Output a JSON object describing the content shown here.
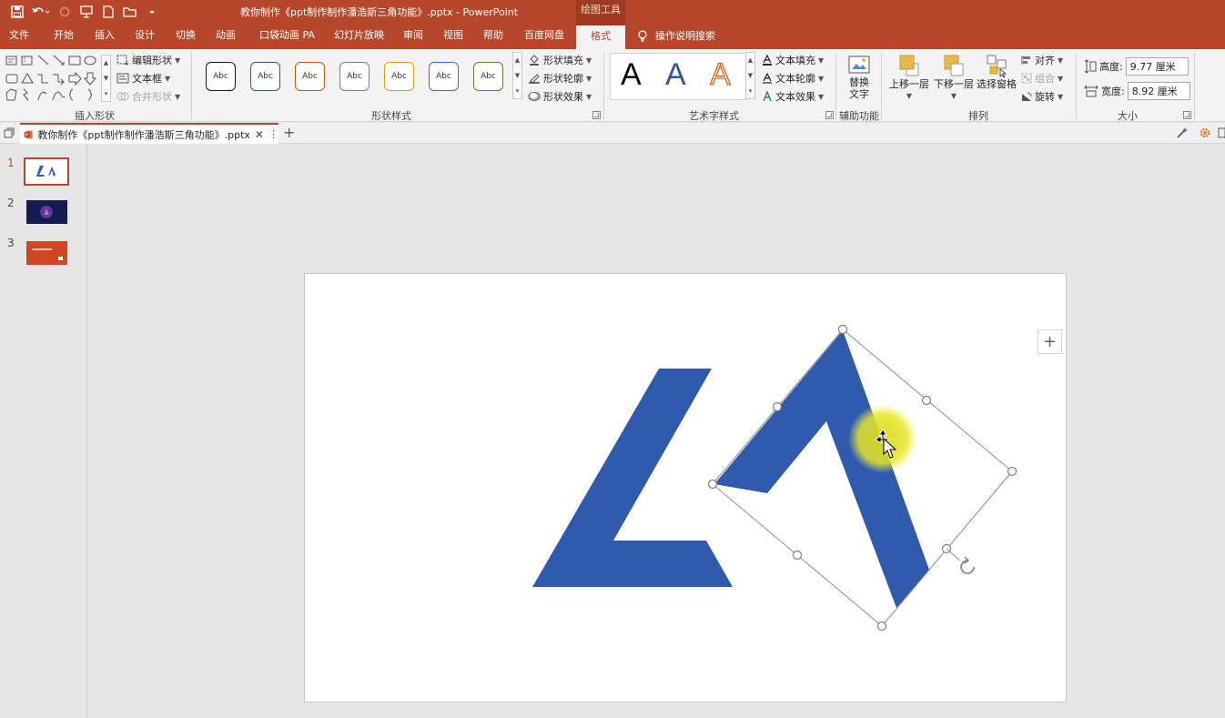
{
  "window": {
    "title": "教你制作《ppt制作制作潘浩斯三角功能》.pptx  -  PowerPoint",
    "context_tab_group": "绘图工具"
  },
  "tabs": [
    {
      "label": "文件"
    },
    {
      "label": "开始"
    },
    {
      "label": "插入"
    },
    {
      "label": "设计"
    },
    {
      "label": "切换"
    },
    {
      "label": "动画"
    },
    {
      "label": "口袋动画 PA"
    },
    {
      "label": "幻灯片放映"
    },
    {
      "label": "审阅"
    },
    {
      "label": "视图"
    },
    {
      "label": "帮助"
    },
    {
      "label": "百度网盘"
    },
    {
      "label": "格式"
    }
  ],
  "tell_me": "操作说明搜索",
  "ribbon": {
    "insert_shapes": {
      "label": "插入形状",
      "edit_shape": "编辑形状",
      "text_box": "文本框",
      "merge_shapes": "合并形状"
    },
    "shape_styles": {
      "label": "形状样式",
      "presets": [
        {
          "text": "Abc",
          "color": "#1a1a1a"
        },
        {
          "text": "Abc",
          "color": "#2f5597"
        },
        {
          "text": "Abc",
          "color": "#c55a11"
        },
        {
          "text": "Abc",
          "color": "#7f7f7f"
        },
        {
          "text": "Abc",
          "color": "#d6a300"
        },
        {
          "text": "Abc",
          "color": "#2e75b6"
        },
        {
          "text": "Abc",
          "color": "#548235"
        }
      ],
      "fill": "形状填充",
      "outline": "形状轮廓",
      "effects": "形状效果"
    },
    "wordart": {
      "label": "艺术字样式",
      "samples": [
        {
          "text": "A",
          "color": "#000000"
        },
        {
          "text": "A",
          "color": "#2f5597"
        },
        {
          "text": "A",
          "color": "#ed7d31"
        }
      ],
      "text_fill": "文本填充",
      "text_outline": "文本轮廓",
      "text_effects": "文本效果"
    },
    "accessibility": {
      "label": "辅助功能",
      "alt_text": "替换\n文字"
    },
    "arrange": {
      "label": "排列",
      "bring_forward": "上移一层",
      "send_backward": "下移一层",
      "selection_pane": "选择窗格",
      "align": "对齐",
      "group": "组合",
      "rotate": "旋转"
    },
    "size": {
      "label": "大小",
      "height_label": "高度:",
      "height_value": "9.77 厘米",
      "width_label": "宽度:",
      "width_value": "8.92 厘米"
    }
  },
  "document_tab": {
    "title": "教你制作《ppt制作制作潘浩斯三角功能》.pptx"
  },
  "slides": [
    {
      "number": "1",
      "active": true
    },
    {
      "number": "2",
      "active": false
    },
    {
      "number": "3",
      "active": false
    }
  ],
  "colors": {
    "accent": "#b7472a",
    "shape_blue": "#2f5aae",
    "highlight": "#e6e62a"
  }
}
